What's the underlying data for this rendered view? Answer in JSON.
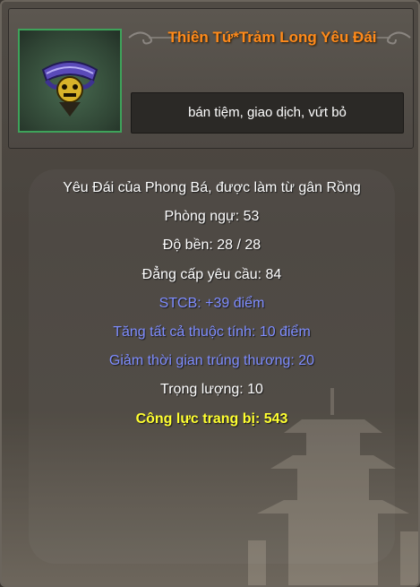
{
  "item": {
    "name": "Thiên Tứ*Trảm Long Yêu Đái",
    "icon": "belt-icon",
    "actions_text": "bán tiệm, giao dịch, vứt bỏ"
  },
  "details": {
    "description": "Yêu Đái của Phong Bá, được làm từ gân Rồng",
    "defense": "Phòng ngự: 53",
    "durability": "Độ bền:  28 /  28",
    "level_required": "Đẳng cấp yêu cầu: 84",
    "stcb": "STCB: +39 điểm",
    "all_attributes": "Tăng tất cả thuộc tính: 10 điểm",
    "hit_recovery": "Giảm thời gian trúng thương: 20",
    "weight": "Trọng lượng: 10",
    "combat_power": "Công lực trang bị: 543"
  },
  "colors": {
    "title": "#ff8a1a",
    "normal": "#ffffff",
    "magic": "#7f8dff",
    "power": "#ffff30",
    "icon_border": "#3ea35a"
  }
}
